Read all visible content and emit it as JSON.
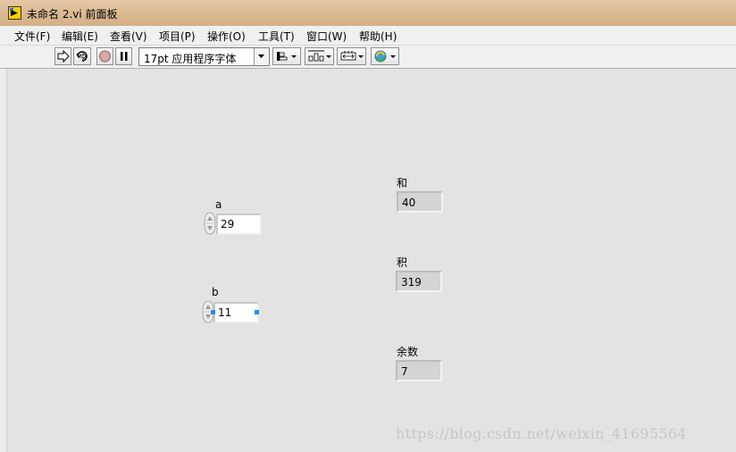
{
  "window": {
    "title": "未命名 2.vi 前面板"
  },
  "menu": [
    {
      "label": "文件(F)"
    },
    {
      "label": "编辑(E)"
    },
    {
      "label": "查看(V)"
    },
    {
      "label": "项目(P)"
    },
    {
      "label": "操作(O)"
    },
    {
      "label": "工具(T)"
    },
    {
      "label": "窗口(W)"
    },
    {
      "label": "帮助(H)"
    }
  ],
  "toolbar": {
    "font_selector": "17pt 应用程序字体"
  },
  "controls": {
    "a": {
      "label": "a",
      "value": "29"
    },
    "b": {
      "label": "b",
      "value": "11"
    }
  },
  "indicators": {
    "sum": {
      "label": "和",
      "value": "40"
    },
    "product": {
      "label": "积",
      "value": "319"
    },
    "remainder": {
      "label": "余数",
      "value": "7"
    }
  },
  "watermark": "https://blog.csdn.net/weixin_41695564",
  "colors": {
    "title_bar": "#d8b78f",
    "panel_background": "#e3e3e3",
    "selection_handle": "#2a8de0"
  }
}
